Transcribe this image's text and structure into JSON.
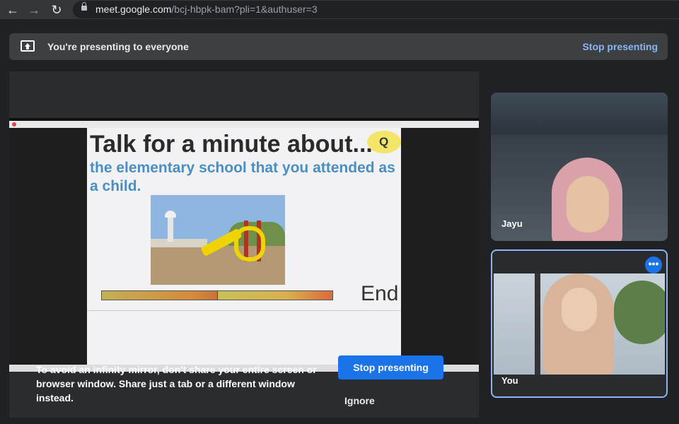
{
  "browser": {
    "url_host": "meet.google.com",
    "url_path": "/bcj-hbpk-bam?pli=1&authuser=3",
    "back_icon": "←",
    "forward_icon": "→",
    "reload_icon": "↻"
  },
  "banner": {
    "text": "You're presenting to everyone",
    "stop_label": "Stop presenting"
  },
  "slide": {
    "title": "Talk for a minute about...",
    "subtitle": "the elementary school that you attended as a child.",
    "badge": "Q",
    "end_label": "End"
  },
  "warning": {
    "text": "To avoid an infinity mirror, don't share your entire screen or browser window. Share just a tab or a different window instead.",
    "stop_label": "Stop presenting",
    "ignore_label": "Ignore"
  },
  "participants": [
    {
      "name": "Jayu"
    },
    {
      "name": "You",
      "more_icon": "•••"
    }
  ],
  "colors": {
    "accent": "#1a73e8",
    "link": "#8ab4f8",
    "background": "#202124"
  }
}
